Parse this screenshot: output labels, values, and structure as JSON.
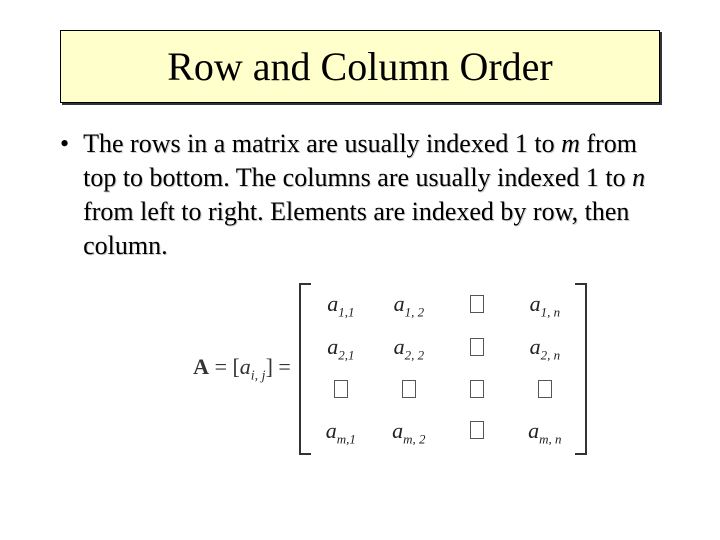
{
  "title": "Row and Column Order",
  "bullet": {
    "pre": "The rows in a matrix are usually indexed 1 to ",
    "m": "m",
    "mid1": " from top to bottom.  The columns are usually indexed 1 to ",
    "n": "n",
    "post": " from left to right.  Elements are indexed by row, then column."
  },
  "formula": {
    "A": "A",
    "eq1": " = [",
    "a": "a",
    "ij": "i, j",
    "eq2": "] ="
  },
  "matrix": {
    "r1": {
      "c1": {
        "b": "a",
        "s": "1,1"
      },
      "c2": {
        "b": "a",
        "s": "1, 2"
      },
      "c4": {
        "b": "a",
        "s": "1, n"
      }
    },
    "r2": {
      "c1": {
        "b": "a",
        "s": "2,1"
      },
      "c2": {
        "b": "a",
        "s": "2, 2"
      },
      "c4": {
        "b": "a",
        "s": "2, n"
      }
    },
    "r4": {
      "c1": {
        "b": "a",
        "s": "m,1"
      },
      "c2": {
        "b": "a",
        "s": "m, 2"
      },
      "c4": {
        "b": "a",
        "s": "m, n"
      }
    }
  }
}
